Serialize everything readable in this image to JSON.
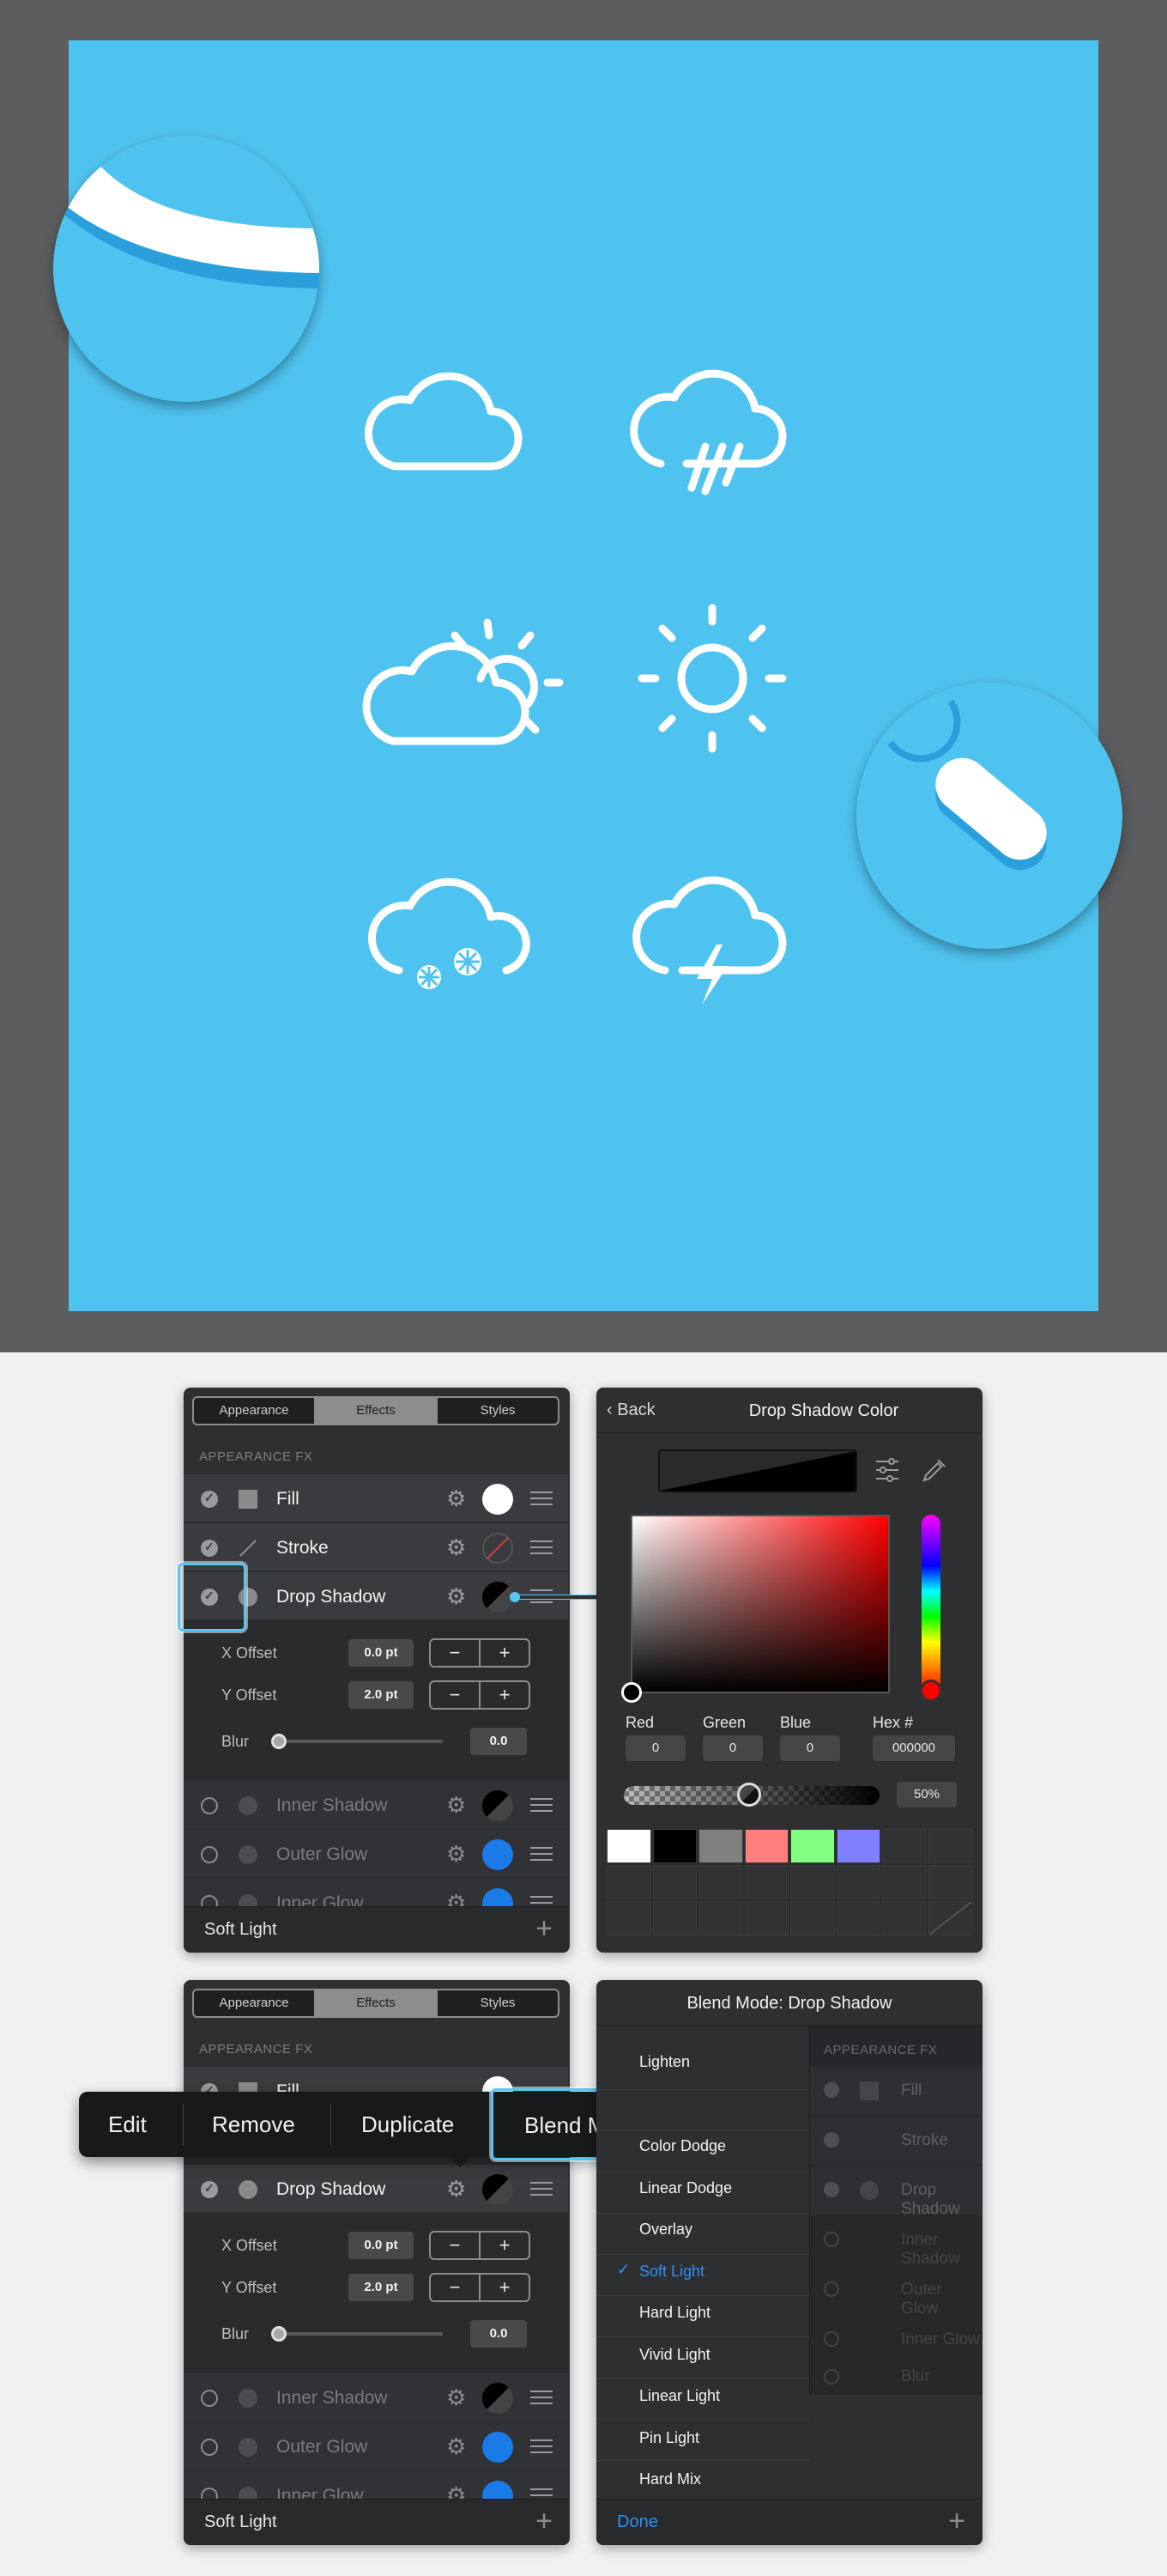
{
  "colors": {
    "canvas": "#4fc3ef",
    "accent": "#2f8ef6",
    "panel": "#2e2f31",
    "highlight": "#5cc6f2"
  },
  "icons": [
    "cloud-icon",
    "cloud-rain-icon",
    "partly-cloudy-icon",
    "sun-icon",
    "cloud-snow-icon",
    "cloud-lightning-icon"
  ],
  "panel1": {
    "tabs": [
      "Appearance",
      "Effects",
      "Styles"
    ],
    "selected_tab": "Effects",
    "section": "APPEARANCE FX",
    "rows": [
      {
        "label": "Fill",
        "checked": true
      },
      {
        "label": "Stroke",
        "checked": true
      },
      {
        "label": "Drop Shadow",
        "checked": true
      }
    ],
    "x_offset_label": "X Offset",
    "x_offset_value": "0.0 pt",
    "y_offset_label": "Y Offset",
    "y_offset_value": "2.0 pt",
    "blur_label": "Blur",
    "blur_value": "0.0",
    "dim_rows": [
      {
        "label": "Inner Shadow",
        "checked": false
      },
      {
        "label": "Outer Glow",
        "checked": false
      },
      {
        "label": "Inner Glow",
        "checked": false
      }
    ],
    "footer": "Soft Light"
  },
  "color_panel": {
    "back": "Back",
    "title": "Drop Shadow Color",
    "red_label": "Red",
    "red": "0",
    "green_label": "Green",
    "green": "0",
    "blue_label": "Blue",
    "blue": "0",
    "hex_label": "Hex #",
    "hex": "000000",
    "opacity": "50%",
    "swatches": [
      "#ffffff",
      "#000000",
      "#808080",
      "#ff7f7f",
      "#80ff80",
      "#8080ff"
    ]
  },
  "context_menu": {
    "items": [
      "Edit",
      "Remove",
      "Duplicate",
      "Blend Mode"
    ],
    "selected": "Blend Mode"
  },
  "blend_panel": {
    "title": "Blend Mode: Drop Shadow",
    "modes": [
      "Lighten",
      "",
      "Color Dodge",
      "Linear Dodge",
      "Overlay",
      "Soft Light",
      "Hard Light",
      "Vivid Light",
      "Linear Light",
      "Pin Light",
      "Hard Mix"
    ],
    "selected": "Soft Light",
    "done": "Done",
    "behind_section": "APPEARANCE FX",
    "behind_items": [
      "Fill",
      "Stroke",
      "Drop Shadow",
      "Inner Shadow",
      "Outer Glow",
      "Inner Glow",
      "Blur"
    ]
  },
  "panel2_partial_label": "Fill"
}
